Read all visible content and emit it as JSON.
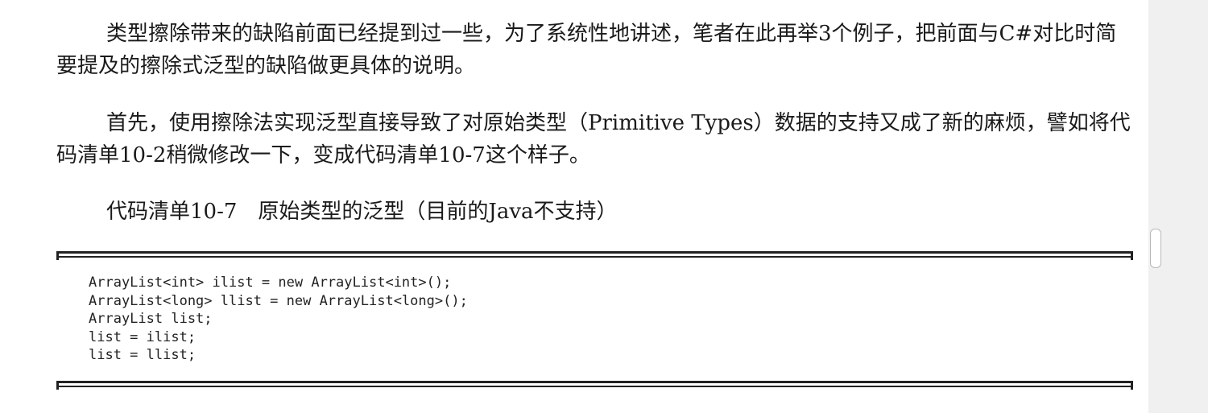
{
  "document": {
    "paragraph_1": "类型擦除带来的缺陷前面已经提到过一些，为了系统性地讲述，笔者在此再举3个例子，把前面与C#对比时简要提及的擦除式泛型的缺陷做更具体的说明。",
    "paragraph_2": "首先，使用擦除法实现泛型直接导致了对原始类型（Primitive Types）数据的支持又成了新的麻烦，譬如将代码清单10-2稍微修改一下，变成代码清单10-7这个样子。",
    "listing_caption": "代码清单10-7　原始类型的泛型（目前的Java不支持）",
    "code_lines": [
      "ArrayList<int> ilist = new ArrayList<int>();",
      "ArrayList<long> llist = new ArrayList<long>();",
      "ArrayList list;",
      "list = ilist;",
      "list = llist;"
    ]
  }
}
